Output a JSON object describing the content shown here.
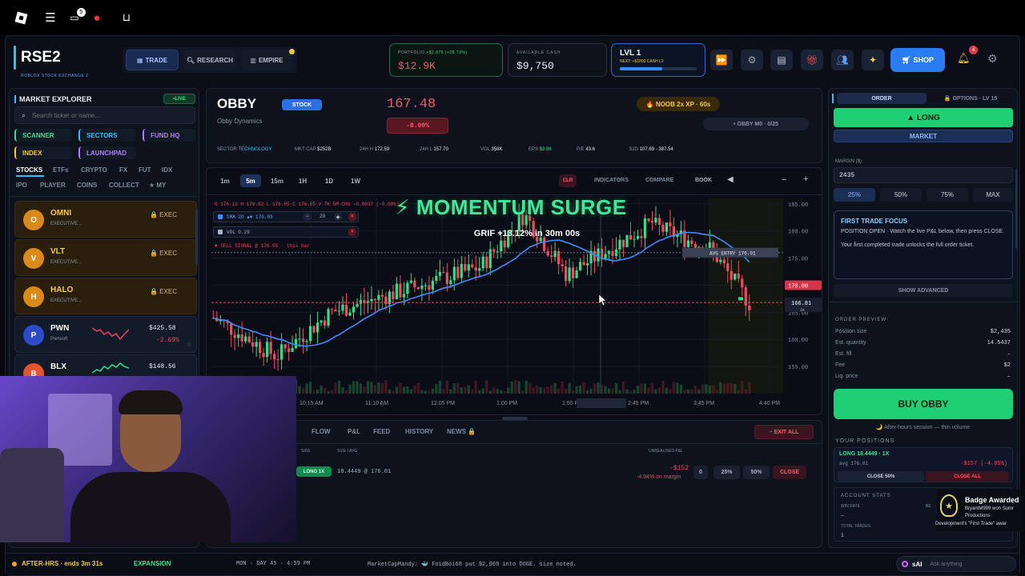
{
  "roblox_bar": {
    "chat_badge": "5"
  },
  "brand": {
    "name": "RSE2",
    "subtitle": "ROBLOX STOCK EXCHANGE 2"
  },
  "nav": {
    "trade": "TRADE",
    "research": "RESEARCH",
    "empire": "EMPIRE"
  },
  "portfolio": {
    "label": "PORTFOLIO",
    "change": "+$2,879 (+28.73%)",
    "value": "$12.9K"
  },
  "cash": {
    "label": "AVAILABLE CASH",
    "value": "$9,750"
  },
  "level": {
    "label": "LVL 1",
    "next": "NEXT: +$1800 CASH L2",
    "progress": 0.55
  },
  "shop": {
    "label": "SHOP"
  },
  "notifications": {
    "count": "4"
  },
  "explorer": {
    "title": "MARKET EXPLORER",
    "live": "•LIVE",
    "search_placeholder": "Search ticker or name...",
    "chips": [
      "SCANNER",
      "SECTORS",
      "FUND HQ",
      "INDEX",
      "LAUNCHPAD"
    ],
    "tabs1": [
      "STOCKS",
      "ETFs",
      "CRYPTO",
      "FX",
      "FUT",
      "IDX"
    ],
    "tabs2": [
      "IPO",
      "PLAYER",
      "COINS",
      "COLLECT",
      "★ MY"
    ],
    "tickers": [
      {
        "letter": "O",
        "symbol": "OMNI",
        "sub": "EXECUTIVE...",
        "tag": "🔒 EXEC"
      },
      {
        "letter": "V",
        "symbol": "VLT",
        "sub": "EXECUTIVE...",
        "tag": "🔒 EXEC"
      },
      {
        "letter": "H",
        "symbol": "HALO",
        "sub": "EXECUTIVE...",
        "tag": "🔒 EXEC"
      },
      {
        "letter": "P",
        "symbol": "PWN",
        "sub": "Pwnsoft",
        "price": "$425.58",
        "change": "-2.69%"
      },
      {
        "letter": "B",
        "symbol": "BLX",
        "sub": "",
        "price": "$148.56",
        "change": ""
      }
    ]
  },
  "stock": {
    "symbol": "OBBY",
    "name": "Obby Dynamics",
    "badge": "STOCK",
    "price": "167.48",
    "change": "-8.00%",
    "noob": "🔥 NOOB 2x XP · 60s",
    "mission": "• OBBY M0 · 0/25",
    "stats": [
      {
        "k": "SECTOR",
        "v": "TECHNOLOGY"
      },
      {
        "k": "MKT CAP",
        "v": "$252B"
      },
      {
        "k": "24H H",
        "v": "172.59"
      },
      {
        "k": "24H L",
        "v": "157.70"
      },
      {
        "k": "VOL",
        "v": "358K"
      },
      {
        "k": "EPS",
        "v": "$3.86"
      },
      {
        "k": "P/E",
        "v": "43.6"
      },
      {
        "k": "52D",
        "v": "107.69 - 387.54"
      }
    ]
  },
  "timeframes": [
    "1m",
    "5m",
    "15m",
    "1H",
    "1D",
    "1W"
  ],
  "tools": {
    "indicators": "INDICATORS",
    "compare": "COMPARE",
    "book": "BOOK",
    "clr": "CLR"
  },
  "event": {
    "title": "⚡ MOMENTUM SURGE",
    "sub": "GRIF  +13.12% in 30m 00s"
  },
  "chart_data": {
    "type": "candlestick",
    "ohlc_legend": "O 176.13  H 179.82  L 176.05  C 176.05  V 7K  5M CHG -0.0037 (-0.00%)",
    "sma_label": "SMA 20 ▲▼ 176.09",
    "sma_period": "20",
    "vol_label": "VOL 0.29",
    "signal": "▼ SELL SIGNAL @ 176.05 · this bar",
    "avg_entry_label": "AVG ENTRY  176.01",
    "price_tag_1": "170.00",
    "price_tag_2": "166.81",
    "price_tag_2b": "3s",
    "ylim": [
      150,
      186
    ],
    "yticks": [
      "185.00",
      "180.00",
      "175.00",
      "170.00",
      "165.00",
      "160.00",
      "155.00"
    ],
    "xticks": [
      "10:15 AM",
      "11:10 AM",
      "12:05 PM",
      "1:00 PM",
      "1:55 PM",
      "2:45 PM",
      "3:45 PM",
      "4:40 PM"
    ],
    "avg_entry": 176.01,
    "last": 166.81
  },
  "bottom": {
    "tabs": [
      "FLOW",
      "P&L",
      "FEED",
      "HISTORY",
      "NEWS 🔒"
    ],
    "exit_all": "− EXIT ALL",
    "cols": {
      "side": "SIDE",
      "size": "SIZE / AVG",
      "upnl": "UNREALISED P&L"
    },
    "position": {
      "side": "LONG 1X",
      "size": "18.4449 @ 176.01",
      "pnl": "-$152",
      "pnl_pct": "-4.94% on margin",
      "b1": "0",
      "b25": "25%",
      "b50": "50%",
      "close": "CLOSE"
    }
  },
  "order": {
    "tab_order": "ORDER",
    "tab_options": "🔒 OPTIONS · LV 15",
    "long": "▲ LONG",
    "market": "MARKET",
    "margin_label": "MARGIN ($)",
    "margin_value": "2435",
    "pcts": [
      "25%",
      "50%",
      "75%",
      "MAX"
    ],
    "focus_title": "FIRST TRADE FOCUS",
    "focus_text1": "POSITION OPEN  ·  Watch the live P&L below, then press CLOSE.",
    "focus_text2": "Your first completed trade unlocks the full order ticket.",
    "show_advanced": "SHOW ADVANCED",
    "preview_title": "ORDER PREVIEW",
    "preview": [
      {
        "k": "Position size",
        "v": "$2,435"
      },
      {
        "k": "Est. quantity",
        "v": "14.5437"
      },
      {
        "k": "Est. fill",
        "v": "–"
      },
      {
        "k": "Fee",
        "v": "$2"
      },
      {
        "k": "Liq. price",
        "v": "–"
      }
    ],
    "buy": "BUY OBBY",
    "after_hours": "🌙 After-hours session — thin volume",
    "positions_title": "YOUR POSITIONS",
    "pos_label": "LONG 18.4449 · 1X",
    "pos_avg": "avg 176.01",
    "pos_pnl": "-$157 (-4.85%)",
    "close50": "CLOSE 50%",
    "closeall": "CLOSE ALL",
    "acct_title": "ACCOUNT STATS",
    "win_rate": "WIN RATE",
    "win_val": "–",
    "total_trades": "TOTAL TRADES",
    "trades_val": "1",
    "best": "BE"
  },
  "badge": {
    "title": "Badge Awarded",
    "l1": "BryantM999 won Sumr",
    "l2": "Productions",
    "l3": "Development's \"First Trade\" awar"
  },
  "status": {
    "session": "AFTER-HRS · ends 3m 31s",
    "phase": "EXPANSION",
    "clock": "MON  ·  DAY 45  ·  4:59 PM",
    "ticker": "MarketCapMandy: 🐳 FoidBoi68 put $2,969 into DOGE. size noted.",
    "ai_label": "sAI",
    "ai_placeholder": "Ask anything"
  }
}
